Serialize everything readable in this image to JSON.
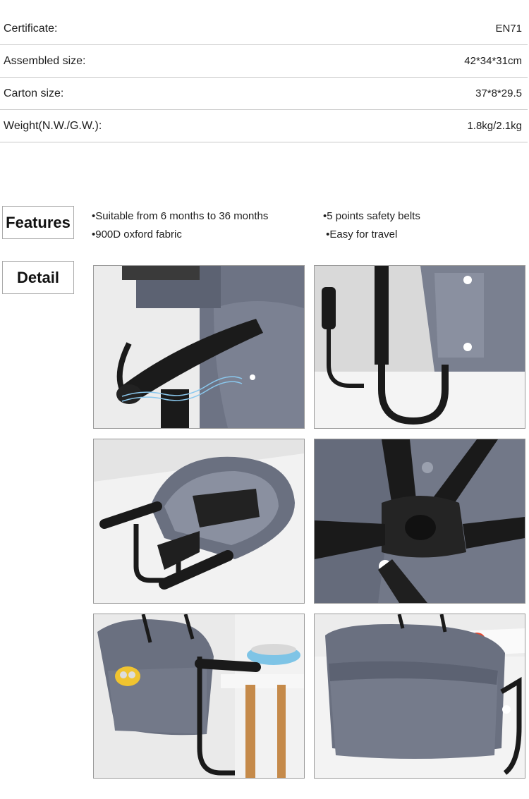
{
  "specs": [
    {
      "label": "Certificate:",
      "value": "EN71"
    },
    {
      "label": "Assembled size:",
      "value": "42*34*31cm"
    },
    {
      "label": "Carton size:",
      "value": "37*8*29.5"
    },
    {
      "label": "Weight(N.W./G.W.):",
      "value": "1.8kg/2.1kg"
    }
  ],
  "features": {
    "heading": "Features",
    "col1": [
      "•Suitable from 6 months to 36 months",
      "•900D oxford fabric"
    ],
    "col2": [
      "•5 points safety belts",
      " •Easy for travel"
    ]
  },
  "detail": {
    "heading": "Detail",
    "photos": [
      {
        "subject": "handle-grip-closeup"
      },
      {
        "subject": "clamp-arms-side-view"
      },
      {
        "subject": "folded-seat-with-harness"
      },
      {
        "subject": "harness-buckle-closeup"
      },
      {
        "subject": "seat-mounted-on-table-with-toy"
      },
      {
        "subject": "seat-mounted-side-view"
      }
    ]
  },
  "colors": {
    "fabric": "#6a7080",
    "fabric_light": "#8a90a0",
    "frame": "#1a1a1a",
    "table": "#f2f2f2",
    "divider": "#c8c8c8"
  }
}
